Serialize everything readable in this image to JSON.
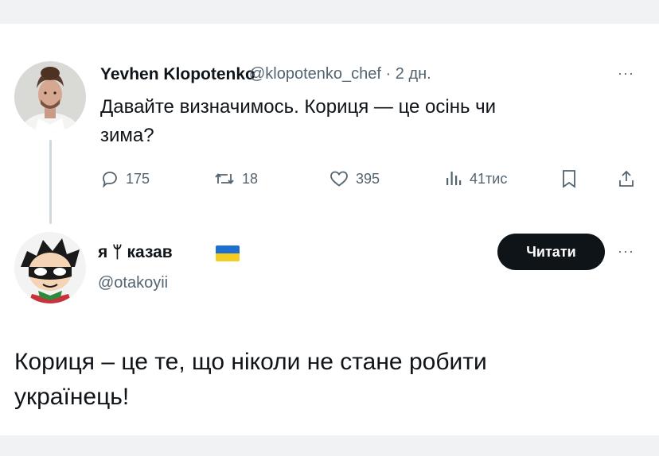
{
  "tweet": {
    "author_name": "Yevhen Klopotenko",
    "handle": "@klopotenko_chef",
    "separator": "·",
    "time": "2 дн.",
    "more": "···",
    "text_line1": "Давайте визначимось. Кориця — це осінь чи",
    "text_line2": "зима?",
    "actions": {
      "replies": "175",
      "reposts": "18",
      "likes": "395",
      "views": "41тис"
    },
    "icons": [
      "comment-icon",
      "repost-icon",
      "heart-icon",
      "views-icon",
      "bookmark-icon",
      "share-icon"
    ]
  },
  "reply": {
    "author_name": "я ᛘ казав",
    "handle": "@otakoyii",
    "follow_label": "Читати",
    "more": "···",
    "text_line1": "Кориця – це те, що ніколи не стане робити",
    "text_line2": "українець!",
    "flag_colors": [
      "#1f6fd1",
      "#f5cd21"
    ]
  },
  "colors": {
    "text": "#0f1419",
    "secondary": "#536471",
    "line": "#cfd9de"
  }
}
